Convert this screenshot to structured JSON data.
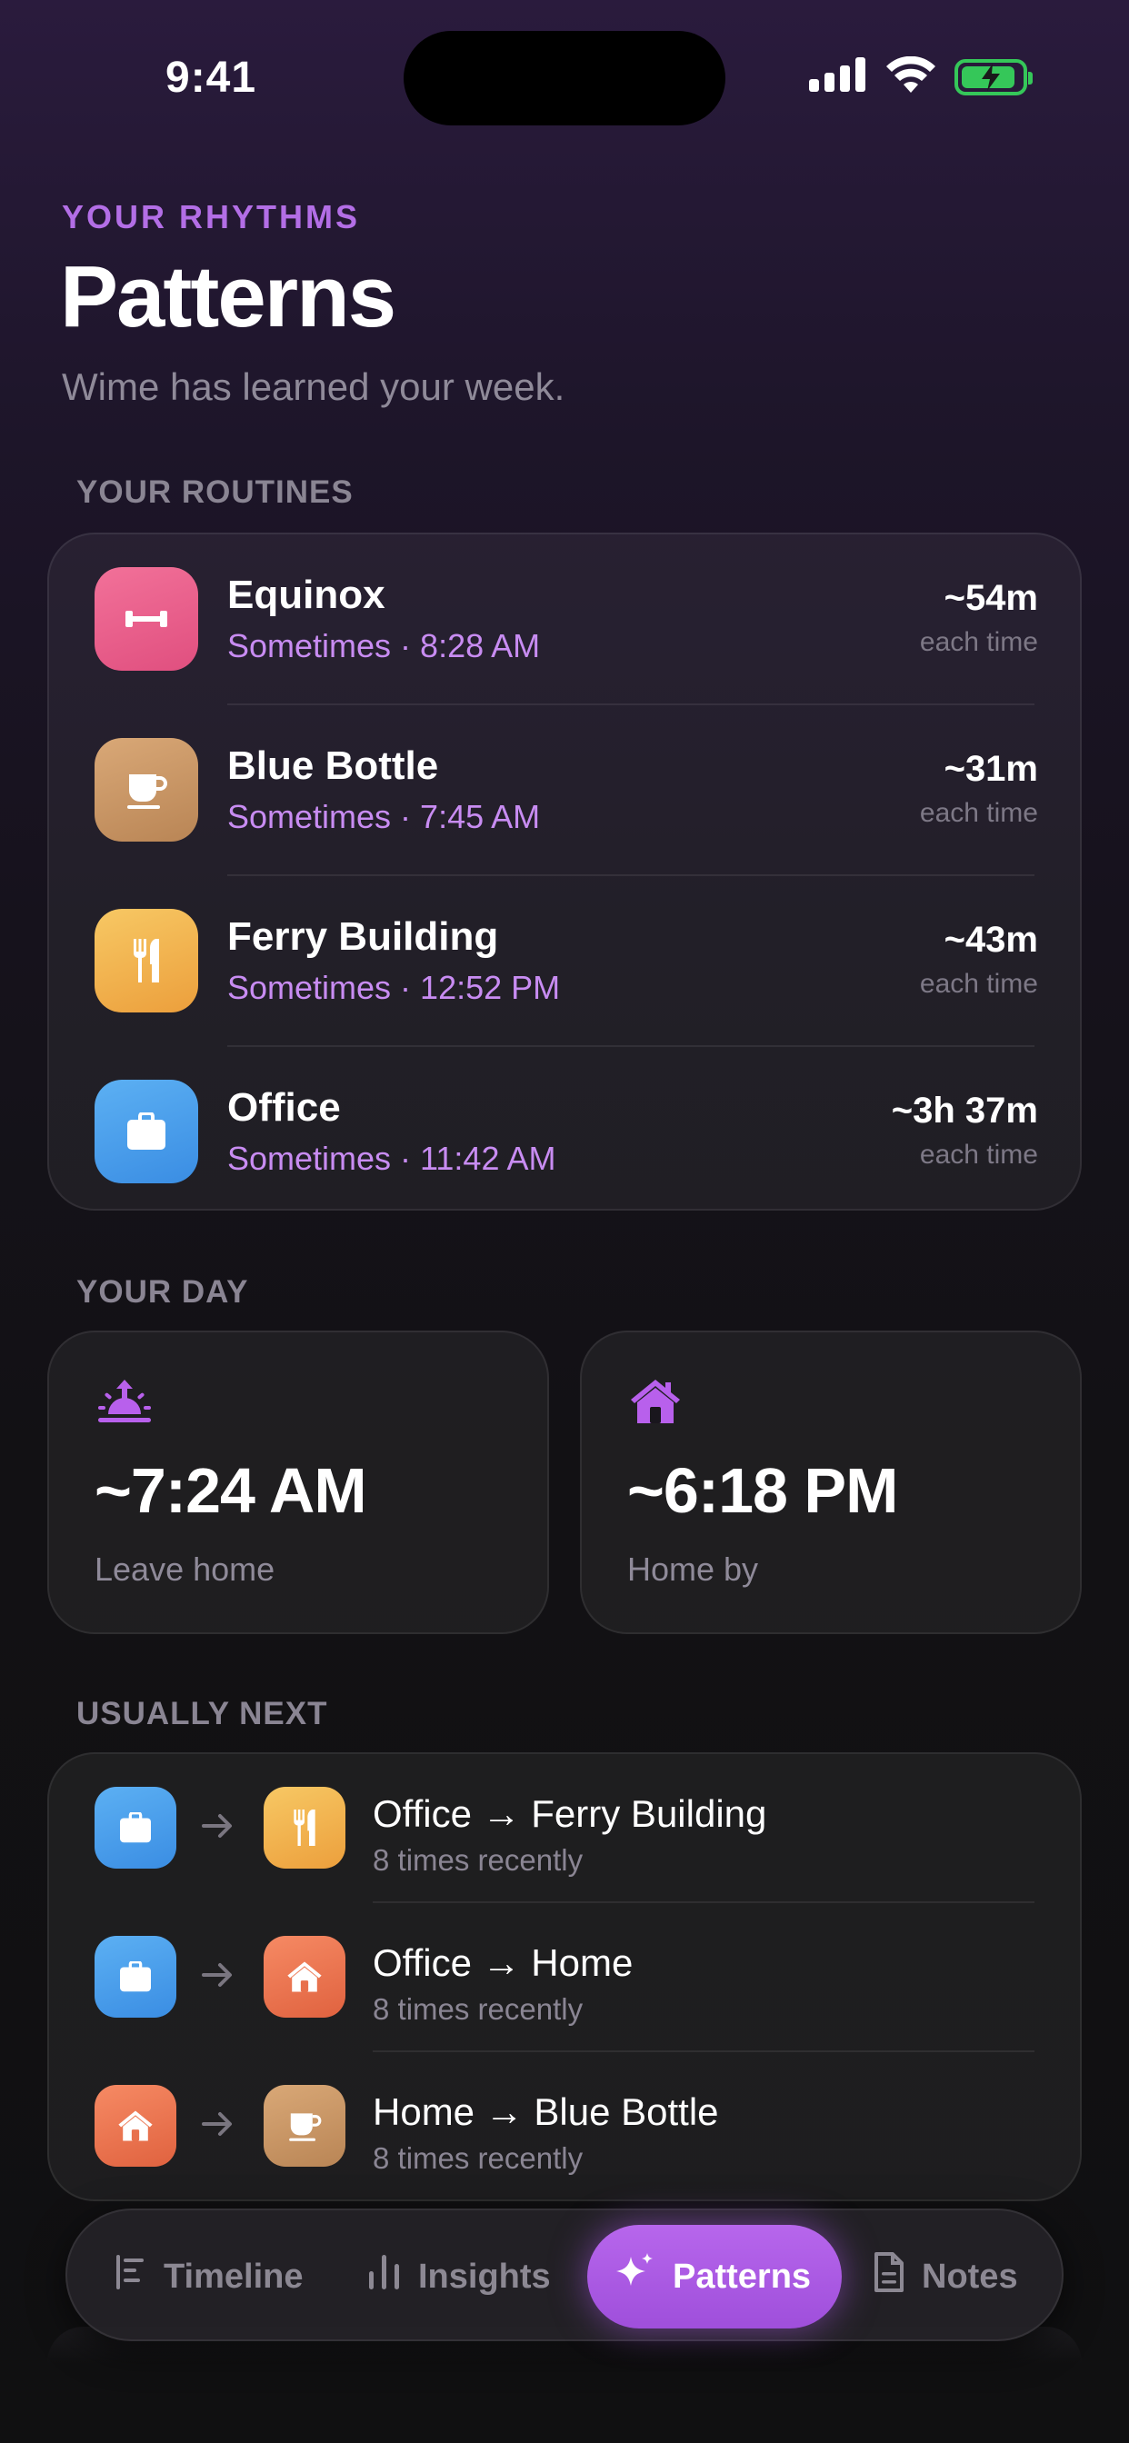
{
  "status_bar": {
    "time": "9:41"
  },
  "header": {
    "eyebrow": "YOUR RHYTHMS",
    "title": "Patterns",
    "subtitle": "Wime has learned your week."
  },
  "routines": {
    "section_label": "YOUR ROUTINES",
    "items": [
      {
        "name": "Equinox",
        "meta": "Sometimes · 8:28 AM",
        "duration": "~54m",
        "unit": "each time",
        "icon": "dumbbell-icon",
        "color": "#e9567f"
      },
      {
        "name": "Blue Bottle",
        "meta": "Sometimes · 7:45 AM",
        "duration": "~31m",
        "unit": "each time",
        "icon": "coffee-cup-icon",
        "color": "#c7925f"
      },
      {
        "name": "Ferry Building",
        "meta": "Sometimes · 12:52 PM",
        "duration": "~43m",
        "unit": "each time",
        "icon": "fork-knife-icon",
        "color": "#f2b44e"
      },
      {
        "name": "Office",
        "meta": "Sometimes · 11:42 AM",
        "duration": "~3h 37m",
        "unit": "each time",
        "icon": "briefcase-icon",
        "color": "#4a9ee9"
      }
    ]
  },
  "your_day": {
    "section_label": "YOUR DAY",
    "leave": {
      "time": "~7:24 AM",
      "label": "Leave home",
      "icon": "sunrise-icon"
    },
    "home": {
      "time": "~6:18 PM",
      "label": "Home by",
      "icon": "house-icon"
    }
  },
  "usually_next": {
    "section_label": "USUALLY NEXT",
    "items": [
      {
        "title": "Office → Ferry Building",
        "sub": "8 times recently",
        "from_icon": "briefcase-icon",
        "to_icon": "fork-knife-icon"
      },
      {
        "title": "Office → Home",
        "sub": "8 times recently",
        "from_icon": "briefcase-icon",
        "to_icon": "house-icon"
      },
      {
        "title": "Home → Blue Bottle",
        "sub": "8 times recently",
        "from_icon": "house-icon",
        "to_icon": "coffee-cup-icon"
      }
    ]
  },
  "tab_bar": {
    "tabs": [
      {
        "label": "Timeline",
        "icon": "timeline-icon",
        "active": false
      },
      {
        "label": "Insights",
        "icon": "bar-chart-icon",
        "active": false
      },
      {
        "label": "Patterns",
        "icon": "sparkles-icon",
        "active": true
      },
      {
        "label": "Notes",
        "icon": "document-icon",
        "active": false
      }
    ]
  },
  "colors": {
    "accent": "#b36ee6",
    "meta_text": "#c88cf2",
    "battery": "#35c759"
  }
}
